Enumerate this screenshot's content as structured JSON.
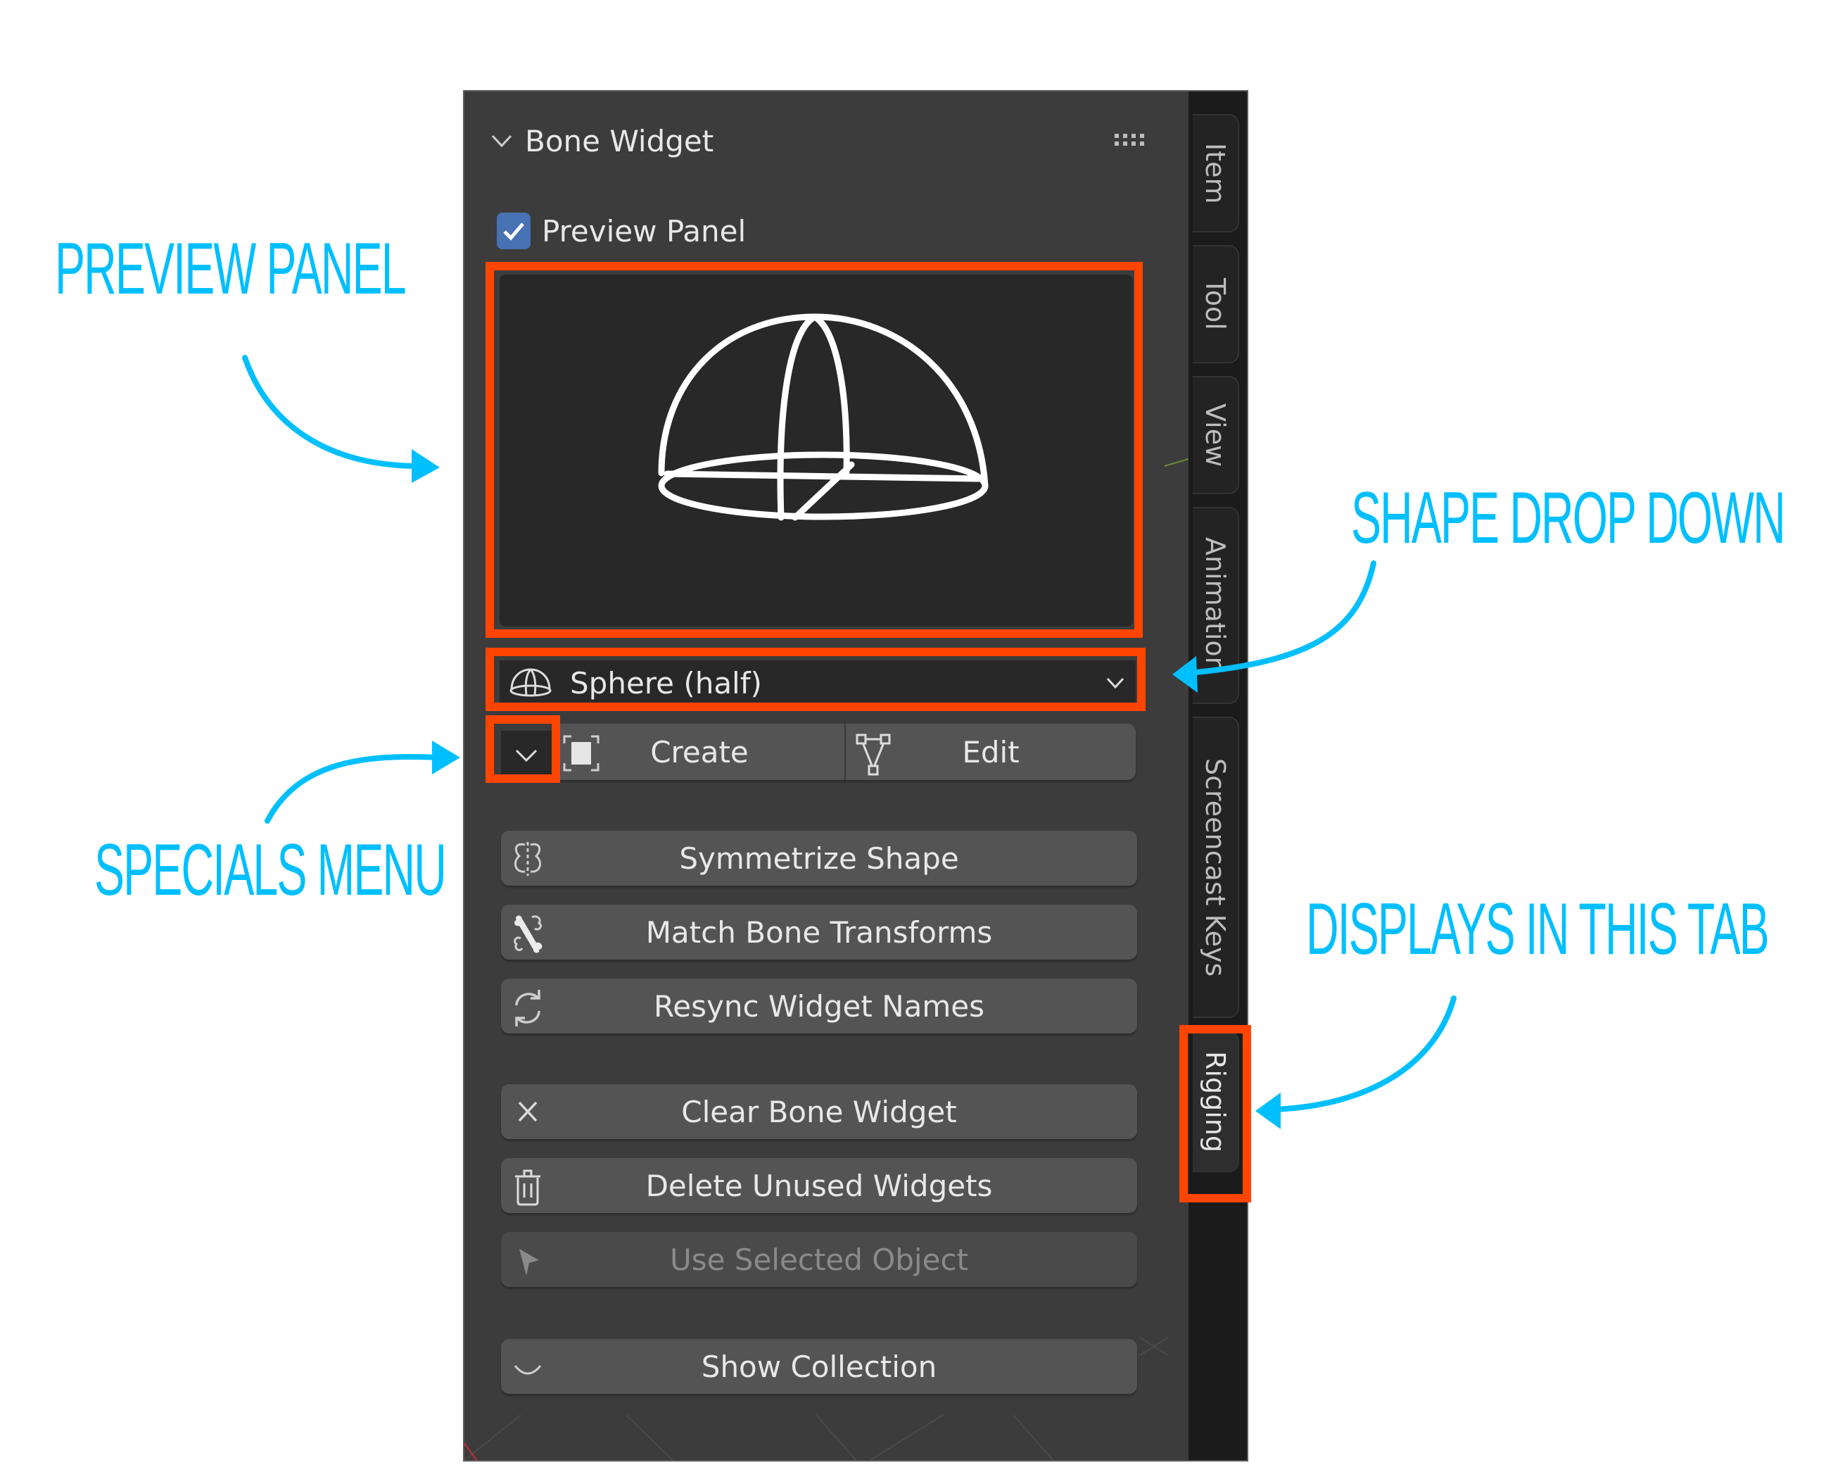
{
  "panel": {
    "header": {
      "title": "Bone Widget",
      "collapse_icon": "chevron-down-icon",
      "drag_icon": "grip-icon"
    },
    "preview_checkbox": {
      "label": "Preview Panel",
      "checked": true
    },
    "preview": {
      "shape_icon": "half-sphere-wireframe-icon"
    },
    "shape_dropdown": {
      "value": "Sphere (half)",
      "icon": "half-sphere-icon"
    },
    "specials_menu": {
      "icon": "chevron-down-icon"
    },
    "create_button": {
      "label": "Create",
      "icon": "create-widget-icon"
    },
    "edit_button": {
      "label": "Edit",
      "icon": "vertex-edit-icon"
    },
    "buttons": [
      {
        "label": "Symmetrize Shape",
        "icon": "mirror-icon",
        "enabled": true
      },
      {
        "label": "Match Bone Transforms",
        "icon": "bone-icon",
        "enabled": true
      },
      {
        "label": "Resync Widget Names",
        "icon": "refresh-icon",
        "enabled": true
      },
      {
        "label": "Clear Bone Widget",
        "icon": "x-icon",
        "enabled": true
      },
      {
        "label": "Delete Unused Widgets",
        "icon": "trash-icon",
        "enabled": true
      },
      {
        "label": "Use Selected Object",
        "icon": "cursor-icon",
        "enabled": false
      },
      {
        "label": "Show Collection",
        "icon": "hide-off-icon",
        "enabled": true
      }
    ]
  },
  "tabs": [
    {
      "label": "Item",
      "active": false
    },
    {
      "label": "Tool",
      "active": false
    },
    {
      "label": "View",
      "active": false
    },
    {
      "label": "Animation",
      "active": false
    },
    {
      "label": "Screencast Keys",
      "active": false
    },
    {
      "label": "Rigging",
      "active": true
    }
  ],
  "annotations": {
    "preview_panel": "PREVIEW PANEL",
    "shape_drop_down": "SHAPE DROP DOWN",
    "specials_menu": "SPECIALS MENU",
    "displays_in_this_tab": "DISPLAYS IN THIS TAB"
  },
  "colors": {
    "annotation": "#00bfff",
    "highlight": "#ff4500",
    "checkbox": "#4772b3",
    "panel_bg": "#3c3c3c",
    "button_bg": "#545454"
  }
}
